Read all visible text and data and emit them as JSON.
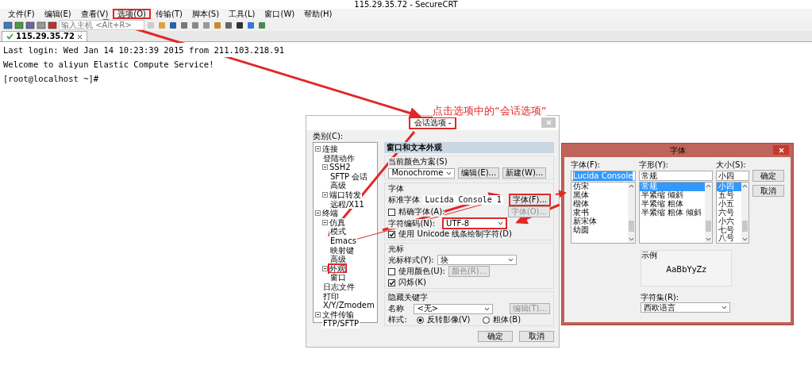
{
  "window": {
    "title": "115.29.35.72 - SecureCRT"
  },
  "menu": [
    {
      "label": "文件(F)",
      "highlighted": false
    },
    {
      "label": "编辑(E)",
      "highlighted": false
    },
    {
      "label": "查看(V)",
      "highlighted": false
    },
    {
      "label": "选项(O)",
      "highlighted": true
    },
    {
      "label": "传输(T)",
      "highlighted": false
    },
    {
      "label": "脚本(S)",
      "highlighted": false
    },
    {
      "label": "工具(L)",
      "highlighted": false
    },
    {
      "label": "窗口(W)",
      "highlighted": false
    },
    {
      "label": "帮助(H)",
      "highlighted": false
    }
  ],
  "toolbar": {
    "host_field": {
      "placeholder": "输入主机 <Alt+R>"
    }
  },
  "tabs": [
    {
      "label": "115.29.35.72",
      "connected": true,
      "selected": true
    }
  ],
  "terminal": {
    "lines": [
      "Last login: Wed Jan 14 10:23:39 2015 from 211.103.218.91",
      "Welcome to aliyun Elastic Compute Service!",
      "[root@localhost ~]#"
    ]
  },
  "annotation": "点击选项中的“会话选项”",
  "session_dialog": {
    "title": "会话选项 - ",
    "title_highlighted": true,
    "category_label": "类别(C):",
    "tree": [
      {
        "label": "连接",
        "highlighted": false,
        "children": [
          {
            "label": "登陆动作",
            "highlighted": false
          },
          {
            "label": "SSH2",
            "highlighted": false,
            "children": [
              {
                "label": "SFTP 会话",
                "highlighted": false
              },
              {
                "label": "高级",
                "highlighted": false
              }
            ]
          },
          {
            "label": "端口转发",
            "highlighted": false,
            "children": [
              {
                "label": "远程/X11",
                "highlighted": false
              }
            ]
          }
        ]
      },
      {
        "label": "终端",
        "highlighted": false,
        "children": [
          {
            "label": "仿真",
            "highlighted": false,
            "children": [
              {
                "label": "模式",
                "highlighted": false
              },
              {
                "label": "Emacs",
                "highlighted": false
              },
              {
                "label": "映射键",
                "highlighted": false
              },
              {
                "label": "高级",
                "highlighted": false
              }
            ]
          },
          {
            "label": "外观",
            "highlighted": true,
            "children": [
              {
                "label": "窗口",
                "highlighted": false
              }
            ]
          },
          {
            "label": "日志文件",
            "highlighted": false
          },
          {
            "label": "打印",
            "highlighted": false
          },
          {
            "label": "X/Y/Zmodem",
            "highlighted": false
          }
        ]
      },
      {
        "label": "文件传输",
        "highlighted": false,
        "children": [
          {
            "label": "FTP/SFTP",
            "highlighted": false
          }
        ]
      }
    ],
    "panel": {
      "heading": "窗口和文本外观",
      "color_scheme": {
        "label": "当前颜色方案(S)",
        "value": "Monochrome",
        "buttons": [
          "编辑(E)...",
          "新建(W)..."
        ]
      },
      "font": {
        "heading": "字体",
        "normal_label": "标准字体",
        "normal_value": "Lucida Console 1",
        "font_button": {
          "label": "字体(F)...",
          "highlighted": true
        },
        "precise": {
          "label": "精确字体(A):",
          "checked": false
        },
        "precise_button": {
          "label": "字体(O)...",
          "disabled": true
        },
        "encoding_label": "字符编码(N):",
        "encoding_value": "UTF-8",
        "encoding_highlighted": true,
        "unicode": {
          "label": "使用 Unicode 线条绘制字符(D)",
          "checked": true
        }
      },
      "cursor": {
        "heading": "光标",
        "style_label": "光标样式(Y):",
        "style_value": "块",
        "use_color": {
          "label": "使用颜色(U):",
          "checked": false
        },
        "color_button": {
          "label": "颜色(R)...",
          "disabled": true
        },
        "blink": {
          "label": "闪烁(K)",
          "checked": true
        }
      },
      "keywords": {
        "heading": "隐藏关键字",
        "name_label": "名称",
        "name_value": "<无>",
        "edit_button": {
          "label": "编辑(T)...",
          "disabled": true
        },
        "style_label": "样式:",
        "styles": [
          {
            "label": "反转影像(V)",
            "selected": true
          },
          {
            "label": "粗体(B)",
            "selected": false
          }
        ]
      }
    },
    "buttons": [
      "确定",
      "取消"
    ]
  },
  "font_dialog": {
    "title": "字体",
    "font_label": "字体(F):",
    "font_value": "Lucida Console",
    "fonts": [
      {
        "label": "仿宋",
        "selected": false
      },
      {
        "label": "黑体",
        "selected": false
      },
      {
        "label": "楷体",
        "selected": false
      },
      {
        "label": "隶书",
        "selected": false
      },
      {
        "label": "新宋体",
        "selected": false
      },
      {
        "label": "幼圆",
        "selected": false
      }
    ],
    "style_label": "字形(Y):",
    "style_value": "常规",
    "styles": [
      {
        "label": "常规",
        "selected": true
      },
      {
        "label": "半紧缩 倾斜",
        "selected": false
      },
      {
        "label": "半紧缩 粗体",
        "selected": false
      },
      {
        "label": "半紧缩 粗体 倾斜",
        "selected": false
      }
    ],
    "size_label": "大小(S):",
    "size_value": "小四",
    "sizes": [
      {
        "label": "小四",
        "selected": true
      },
      {
        "label": "五号",
        "selected": false
      },
      {
        "label": "小五",
        "selected": false
      },
      {
        "label": "六号",
        "selected": false
      },
      {
        "label": "小六",
        "selected": false
      },
      {
        "label": "七号",
        "selected": false
      },
      {
        "label": "八号",
        "selected": false
      }
    ],
    "buttons": [
      "确定",
      "取消"
    ],
    "sample_label": "示例",
    "sample_text": "AaBbYyZz",
    "charset_label": "字符集(R):",
    "charset_value": "西欧语言"
  }
}
